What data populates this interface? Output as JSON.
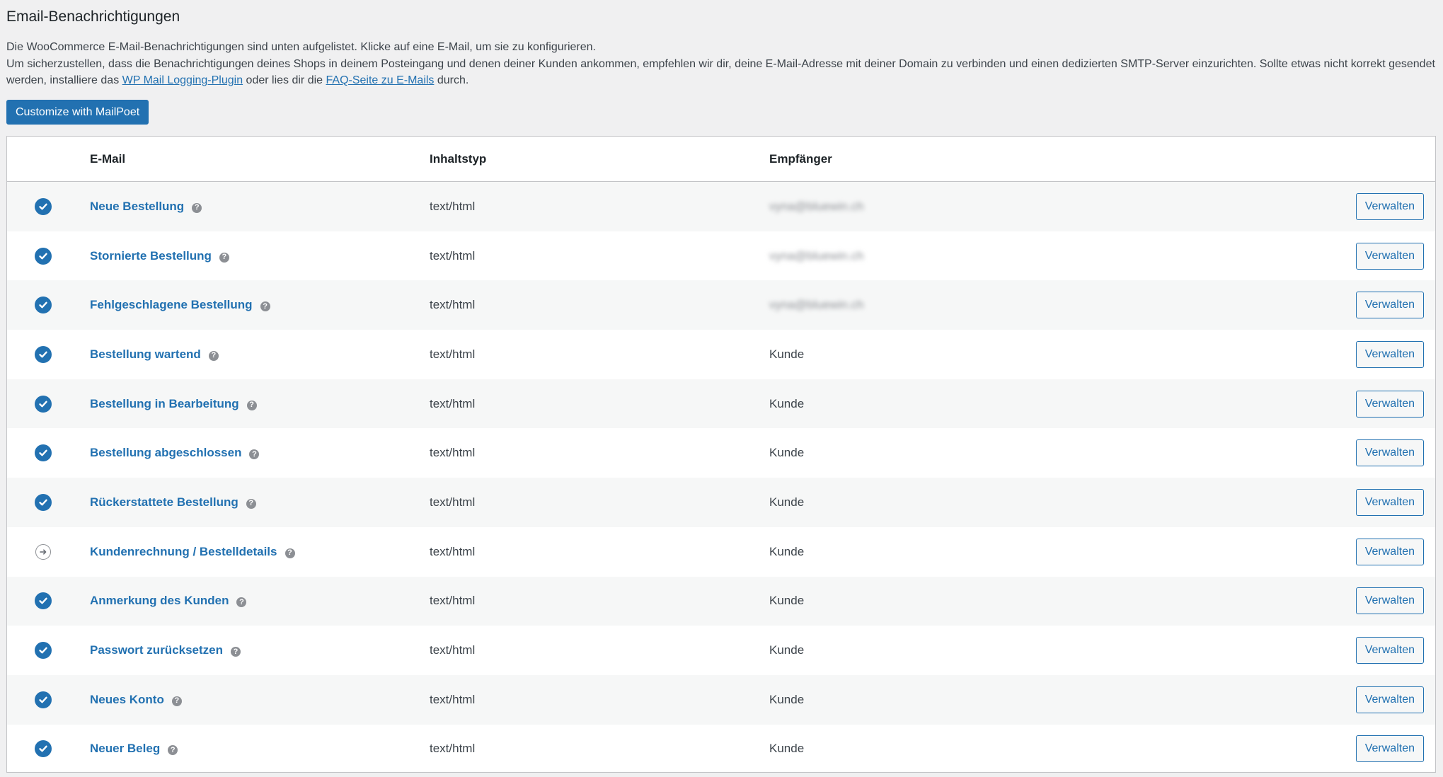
{
  "page": {
    "title": "Email-Benachrichtigungen",
    "description_line1": "Die WooCommerce E-Mail-Benachrichtigungen sind unten aufgelistet. Klicke auf eine E-Mail, um sie zu konfigurieren.",
    "description_line2_before_link1": "Um sicherzustellen, dass die Benachrichtigungen deines Shops in deinem Posteingang und denen deiner Kunden ankommen, empfehlen wir dir, deine E-Mail-Adresse mit deiner Domain zu verbinden und einen dedizierten SMTP-Server einzurichten. Sollte etwas nicht korrekt gesendet werden, installiere das ",
    "link1": "WP Mail Logging-Plugin",
    "description_between_links": " oder lies dir die ",
    "link2": "FAQ-Seite zu E-Mails",
    "description_after_link2": " durch.",
    "mailpoet_button": "Customize with MailPoet"
  },
  "table": {
    "headers": {
      "email": "E-Mail",
      "content_type": "Inhaltstyp",
      "recipient": "Empfänger"
    },
    "manage_label": "Verwalten",
    "help_glyph": "?",
    "rows": [
      {
        "status": "enabled",
        "name": "Neue Bestellung",
        "content_type": "text/html",
        "recipient": "vyna@bluewin.ch",
        "recipient_blurred": true
      },
      {
        "status": "enabled",
        "name": "Stornierte Bestellung",
        "content_type": "text/html",
        "recipient": "vyna@bluewin.ch",
        "recipient_blurred": true
      },
      {
        "status": "enabled",
        "name": "Fehlgeschlagene Bestellung",
        "content_type": "text/html",
        "recipient": "vyna@bluewin.ch",
        "recipient_blurred": true
      },
      {
        "status": "enabled",
        "name": "Bestellung wartend",
        "content_type": "text/html",
        "recipient": "Kunde",
        "recipient_blurred": false
      },
      {
        "status": "enabled",
        "name": "Bestellung in Bearbeitung",
        "content_type": "text/html",
        "recipient": "Kunde",
        "recipient_blurred": false
      },
      {
        "status": "enabled",
        "name": "Bestellung abgeschlossen",
        "content_type": "text/html",
        "recipient": "Kunde",
        "recipient_blurred": false
      },
      {
        "status": "enabled",
        "name": "Rückerstattete Bestellung",
        "content_type": "text/html",
        "recipient": "Kunde",
        "recipient_blurred": false
      },
      {
        "status": "manual",
        "name": "Kundenrechnung / Bestelldetails",
        "content_type": "text/html",
        "recipient": "Kunde",
        "recipient_blurred": false
      },
      {
        "status": "enabled",
        "name": "Anmerkung des Kunden",
        "content_type": "text/html",
        "recipient": "Kunde",
        "recipient_blurred": false
      },
      {
        "status": "enabled",
        "name": "Passwort zurücksetzen",
        "content_type": "text/html",
        "recipient": "Kunde",
        "recipient_blurred": false
      },
      {
        "status": "enabled",
        "name": "Neues Konto",
        "content_type": "text/html",
        "recipient": "Kunde",
        "recipient_blurred": false
      },
      {
        "status": "enabled",
        "name": "Neuer Beleg",
        "content_type": "text/html",
        "recipient": "Kunde",
        "recipient_blurred": false
      }
    ]
  },
  "icons": {
    "enabled": "check-circle-icon",
    "manual": "manual-arrow-circle-icon",
    "help": "help-tip-icon"
  },
  "colors": {
    "accent": "#2271b1",
    "background": "#f0f0f1",
    "row_alt": "#f6f7f7",
    "border": "#c3c4c7"
  }
}
